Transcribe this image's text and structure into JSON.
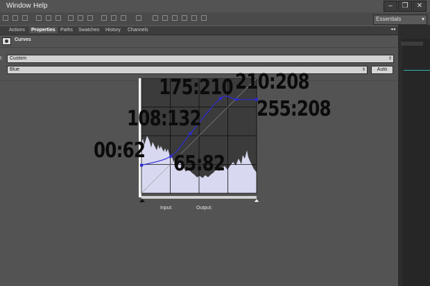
{
  "menu": [
    "Window",
    "Help"
  ],
  "workspace_select": "Essentials",
  "window_buttons": [
    "–",
    "❐",
    "✕"
  ],
  "tabs": [
    {
      "label": "Actions",
      "active": false
    },
    {
      "label": "Properties",
      "active": true
    },
    {
      "label": "Paths",
      "active": false
    },
    {
      "label": "Swatches",
      "active": false
    },
    {
      "label": "History",
      "active": false
    },
    {
      "label": "Channels",
      "active": false
    }
  ],
  "panel_controls": "◂◂",
  "panel_title": "Curves",
  "preset": {
    "label": "t:",
    "value": "Custom"
  },
  "channel": {
    "value": "Blue"
  },
  "auto_label": "Auto",
  "input_label": "Input:",
  "output_label": "Output:",
  "curve_points": [
    {
      "input": 0,
      "output": 62,
      "label": "00:62"
    },
    {
      "input": 65,
      "output": 82,
      "label": "65:82"
    },
    {
      "input": 108,
      "output": 132,
      "label": "108:132"
    },
    {
      "input": 175,
      "output": 210,
      "label": "175:210"
    },
    {
      "input": 210,
      "output": 208,
      "label": "210:208"
    },
    {
      "input": 255,
      "output": 208,
      "label": "255:208"
    }
  ],
  "colors": {
    "curve": "#2d2bd6",
    "histogram": "#d7d7ef",
    "graph_bg": "#3c3c3c",
    "accent_teal": "#2fb5b5"
  },
  "icons": [
    "minimize-icon",
    "restore-icon",
    "close-icon",
    "curves-adjustment-icon",
    "dropdown-arrow-icon",
    "black-point-slider-icon",
    "white-point-slider-icon"
  ]
}
